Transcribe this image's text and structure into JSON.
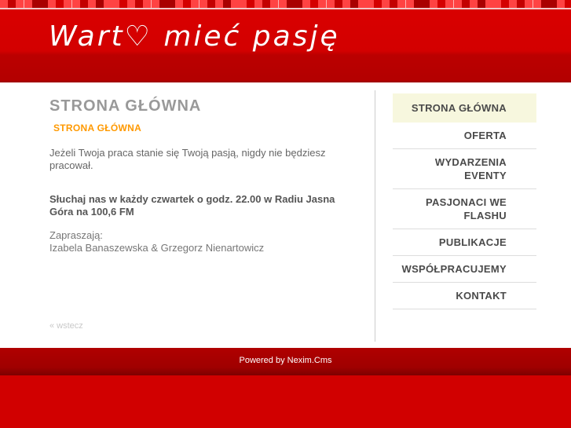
{
  "logo": {
    "text": "Wart♡ mieć pasję"
  },
  "page": {
    "title": "STRONA GŁÓWNA",
    "breadcrumb": "STRONA GŁÓWNA",
    "intro": "Jeżeli Twoja praca stanie się Twoją pasją, nigdy nie będziesz pracował.",
    "highlight": "Słuchaj nas w każdy czwartek o godz. 22.00 w Radiu Jasna Góra na 100,6 FM",
    "hosts_label": "Zapraszają:",
    "hosts_names": "Izabela Banaszewska & Grzegorz Nienartowicz",
    "back_link": "« wstecz"
  },
  "menu": {
    "items": [
      {
        "label": "STRONA GŁÓWNA",
        "active": true
      },
      {
        "label": "OFERTA",
        "active": false
      },
      {
        "label": "WYDARZENIA EVENTY",
        "active": false
      },
      {
        "label": "PASJONACI WE FLASHU",
        "active": false
      },
      {
        "label": "PUBLIKACJE",
        "active": false
      },
      {
        "label": "WSPÓŁPRACUJEMY",
        "active": false
      },
      {
        "label": "KONTAKT",
        "active": false
      }
    ]
  },
  "footer": {
    "powered_by": "Powered by Nexim.Cms"
  },
  "colors": {
    "brand_red": "#d30000",
    "dark_red": "#a00000",
    "accent_orange": "#ff9900",
    "menu_active_bg": "#f7f7de",
    "title_gray": "#999999"
  }
}
